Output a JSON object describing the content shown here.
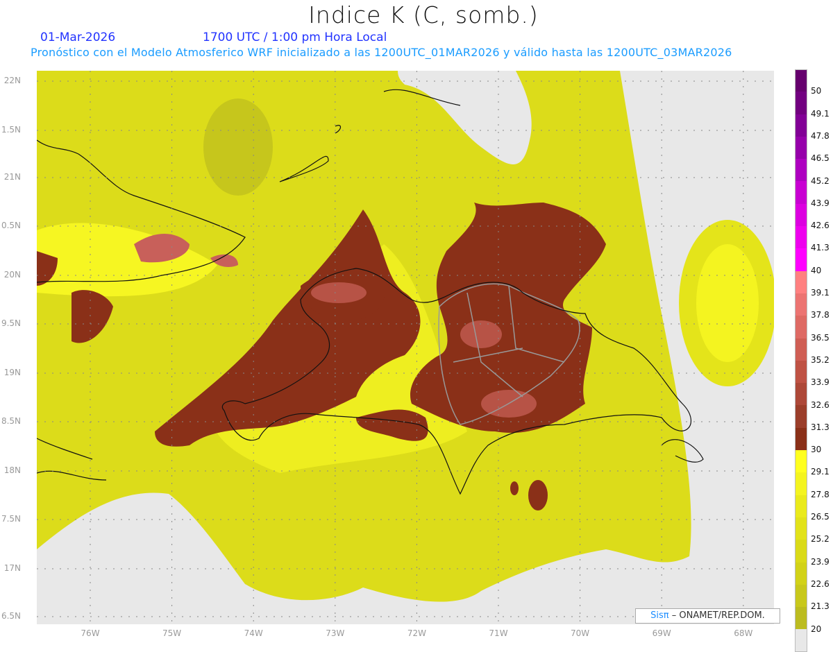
{
  "title": "Indice K (C, somb.)",
  "date": "01-Mar-2026",
  "time": "1700 UTC / 1:00 pm Hora Local",
  "description": "Pronóstico con el Modelo Atmosferico WRF inicializado a las 1200UTC_01MAR2026 y válido hasta las  1200UTC_03MAR2026",
  "axes": {
    "lat_labels": [
      "22N",
      "1.5N",
      "21N",
      "0.5N",
      "20N",
      "9.5N",
      "19N",
      "8.5N",
      "18N",
      "7.5N",
      "17N",
      "6.5N"
    ],
    "lon_labels": [
      "76W",
      "75W",
      "74W",
      "73W",
      "72W",
      "71W",
      "70W",
      "69W",
      "68W"
    ]
  },
  "colorbar": {
    "labels": [
      "50",
      "49.1",
      "47.8",
      "46.5",
      "45.2",
      "43.9",
      "42.6",
      "41.3",
      "40",
      "39.1",
      "37.8",
      "36.5",
      "35.2",
      "33.9",
      "32.6",
      "31.3",
      "30",
      "29.1",
      "27.8",
      "26.5",
      "25.2",
      "23.9",
      "22.6",
      "21.3",
      "20"
    ],
    "colors": [
      "#66006e",
      "#720080",
      "#820096",
      "#9600aa",
      "#ae00c0",
      "#c800d2",
      "#dc00e0",
      "#ee00ee",
      "#ff00ff",
      "#ff8080",
      "#ec7472",
      "#de6a64",
      "#cf5e54",
      "#bf5244",
      "#ad4838",
      "#9b3e2a",
      "#8a3018",
      "#ffff20",
      "#f4f420",
      "#eaea1c",
      "#e2e21a",
      "#dada18",
      "#d2d218",
      "#c8c81c",
      "#bcbc20",
      "#e8e8e8"
    ]
  },
  "credit": {
    "brand": "Sisπ",
    "text": "– ONAMET/REP.DOM."
  }
}
